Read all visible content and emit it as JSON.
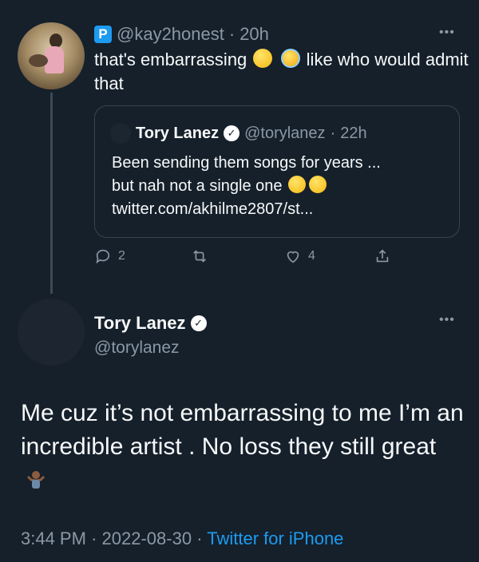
{
  "reply": {
    "handle": "@kay2honest",
    "sep": "·",
    "time": "20h",
    "text_part1": "that's embarrassing",
    "text_part2": "like who would admit that",
    "badge_letter": "P"
  },
  "quoted": {
    "name": "Tory Lanez",
    "handle": "@torylanez",
    "sep": "·",
    "time": "22h",
    "line1": "Been sending them songs for years ...",
    "line2": "but nah not a single one",
    "line3": "twitter.com/akhilme2807/st..."
  },
  "actions": {
    "reply_count": "2",
    "retweet_count": "",
    "like_count": "4"
  },
  "main_tweet": {
    "name": "Tory Lanez",
    "handle": "@torylanez",
    "text": "Me cuz it’s not embarrassing to me I’m an incredible artist . No loss they still great",
    "time": "3:44 PM",
    "date": "2022-08-30",
    "sep": "·",
    "source": "Twitter for iPhone"
  },
  "colors": {
    "background": "#15202b",
    "accent": "#1d9bf0",
    "muted": "#8b98a5"
  },
  "icons": [
    "reply-icon",
    "retweet-icon",
    "like-icon",
    "share-icon",
    "verified-icon",
    "more-icon"
  ]
}
